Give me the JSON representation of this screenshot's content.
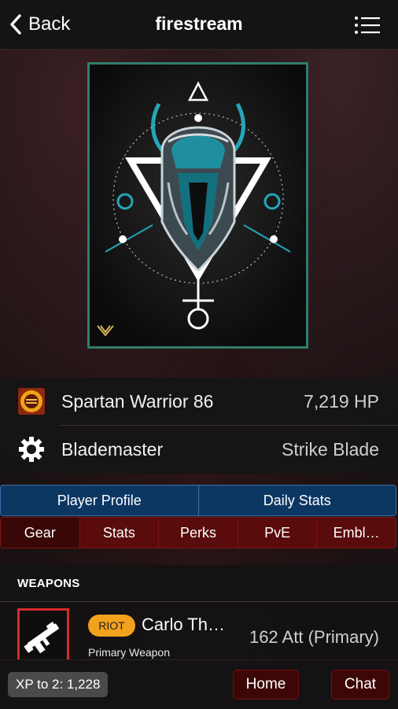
{
  "header": {
    "back_label": "Back",
    "title": "firestream"
  },
  "character": {
    "name": "Spartan Warrior 86",
    "hp": "7,219 HP"
  },
  "subclass": {
    "name": "Blademaster",
    "super": "Strike Blade"
  },
  "primary_tabs": [
    "Player Profile",
    "Daily Stats"
  ],
  "secondary_tabs": [
    "Gear",
    "Stats",
    "Perks",
    "PvE",
    "Embl…"
  ],
  "active_secondary_tab": "Gear",
  "section": {
    "title": "WEAPONS"
  },
  "weapon": {
    "badge": "RIOT",
    "name": "Carlo Th…",
    "type": "Primary Weapon",
    "stat": "162 Att (Primary)"
  },
  "footer": {
    "xp": "XP to 2: 1,228",
    "home_label": "Home",
    "chat_label": "Chat"
  },
  "colors": {
    "emblem_accent": "#23a6b8",
    "frame": "#2e7e6b",
    "tab_blue": "#0d3763",
    "tab_red": "#5a0b0b",
    "badge": "#f2a21c",
    "weapon_border": "#d62a2a"
  },
  "icons": {
    "back": "chevron-left-icon",
    "menu": "list-menu-icon",
    "character": "spartan-helmet-icon",
    "subclass": "gear-icon",
    "weapon": "rifle-icon"
  }
}
